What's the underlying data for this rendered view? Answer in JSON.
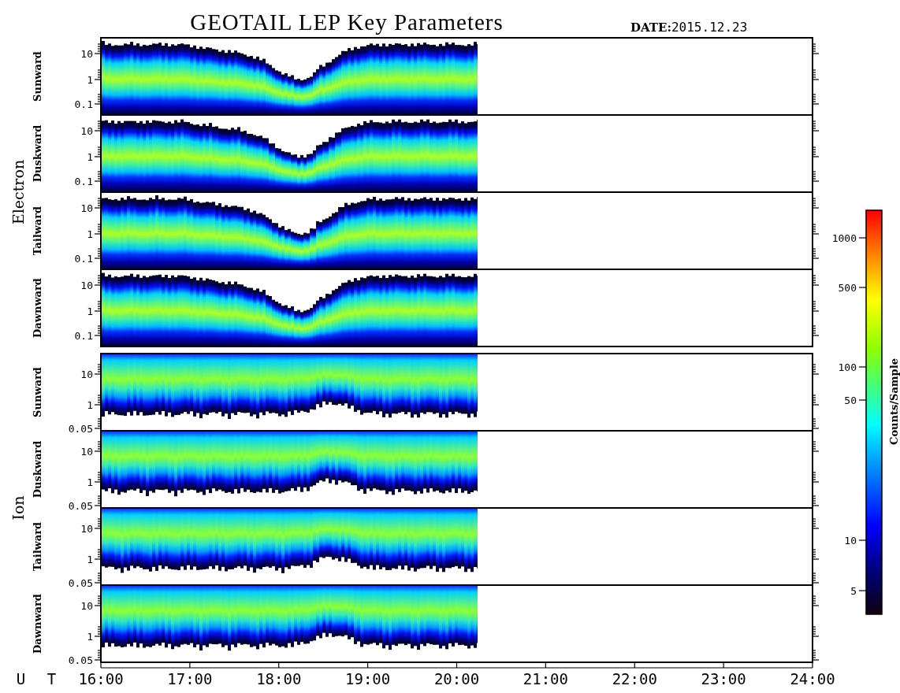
{
  "title": "GEOTAIL LEP Key Parameters",
  "date": {
    "label": "DATE:",
    "value": "2015.12.23"
  },
  "groups": [
    {
      "label": "Electron",
      "kind": "electron",
      "panels": [
        {
          "label": "Sunward",
          "yticks": [
            "10",
            "1",
            "0.1"
          ]
        },
        {
          "label": "Duskward",
          "yticks": [
            "10",
            "1",
            "0.1"
          ]
        },
        {
          "label": "Tailward",
          "yticks": [
            "10",
            "1",
            "0.1"
          ]
        },
        {
          "label": "Dawnward",
          "yticks": [
            "10",
            "1",
            "0.1"
          ]
        }
      ]
    },
    {
      "label": "Ion",
      "kind": "ion",
      "panels": [
        {
          "label": "Sunward",
          "yticks": [
            "10",
            "1",
            "0.05"
          ]
        },
        {
          "label": "Duskward",
          "yticks": [
            "10",
            "1",
            "0.05"
          ]
        },
        {
          "label": "Tailward",
          "yticks": [
            "10",
            "1",
            "0.05"
          ]
        },
        {
          "label": "Dawnward",
          "yticks": [
            "10",
            "1",
            "0.05"
          ]
        }
      ]
    }
  ],
  "x_axis": {
    "label": "U T",
    "ticks": [
      "16:00",
      "17:00",
      "18:00",
      "19:00",
      "20:00",
      "21:00",
      "22:00",
      "23:00",
      "24:00"
    ]
  },
  "colorbar": {
    "label": "Counts/Sample",
    "ticks": [
      "1000",
      "500",
      "100",
      "50",
      "10",
      "5"
    ]
  }
}
